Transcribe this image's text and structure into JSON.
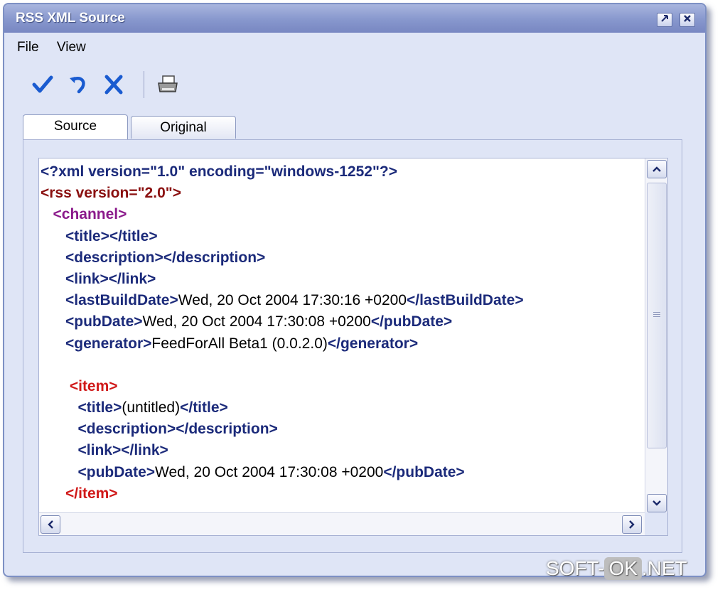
{
  "window": {
    "title": "RSS XML Source"
  },
  "menu": {
    "file": "File",
    "view": "View"
  },
  "toolbar": {
    "icons": [
      "checkmark-icon",
      "undo-icon",
      "close-x-icon",
      "printer-icon"
    ]
  },
  "tabs": [
    {
      "label": "Source",
      "active": true
    },
    {
      "label": "Original",
      "active": false
    }
  ],
  "code": {
    "line1": "<?xml version=\"1.0\" encoding=\"windows-1252\"?>",
    "line2": "<rss version=\"2.0\">",
    "line3": "<channel>",
    "title_open": "<title>",
    "title_close": "</title>",
    "desc_open": "<description>",
    "desc_close": "</description>",
    "link_open": "<link>",
    "link_close": "</link>",
    "lbd_open": "<lastBuildDate>",
    "lbd_value": "Wed, 20 Oct 2004 17:30:16 +0200",
    "lbd_close": "</lastBuildDate>",
    "pub_open": "<pubDate>",
    "pub_value": "Wed, 20 Oct 2004 17:30:08 +0200",
    "pub_close": "</pubDate>",
    "gen_open": "<generator>",
    "gen_value": "FeedForAll Beta1 (0.0.2.0)",
    "gen_close": "</generator>",
    "item_open": "<item>",
    "item_title_value": "(untitled)",
    "item_pub_value": "Wed, 20 Oct 2004 17:30:08 +0200",
    "item_close": "</item>"
  },
  "watermark": {
    "left": "SOFT-",
    "mid": "OK",
    "right": ".NET"
  },
  "colors": {
    "tag": "#1b2a7a",
    "rss": "#8a1010",
    "channel": "#8b1a8b",
    "item": "#d01818",
    "titlebar": "#8797cd"
  }
}
